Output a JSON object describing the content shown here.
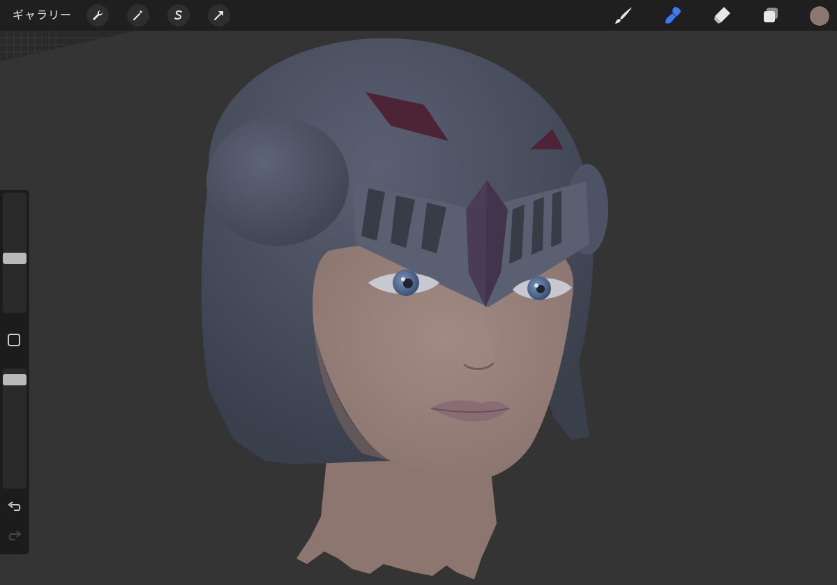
{
  "app": {
    "gallery_label": "ギャラリー"
  },
  "toolbar_left": [
    {
      "name": "actions-wrench-icon"
    },
    {
      "name": "adjustments-magic-wand-icon"
    },
    {
      "name": "selection-s-icon"
    },
    {
      "name": "transform-arrow-icon"
    }
  ],
  "toolbar_right": {
    "tools": [
      {
        "name": "brush-icon",
        "active": false
      },
      {
        "name": "smudge-icon",
        "active": true
      },
      {
        "name": "eraser-icon",
        "active": false
      },
      {
        "name": "layers-icon",
        "active": false
      }
    ],
    "current_color": "#8c7670"
  },
  "sidebar": {
    "brush_size_level": 0.45,
    "opacity_level": 0.95,
    "undo_enabled": true,
    "redo_enabled": false
  },
  "colors": {
    "toolbar_bg": "#1f1f1f",
    "canvas_bg": "#343434",
    "active_tool": "#3a7bf2",
    "helmet": "#4a5060",
    "skin": "#97807a",
    "gem": "#4d2336"
  }
}
